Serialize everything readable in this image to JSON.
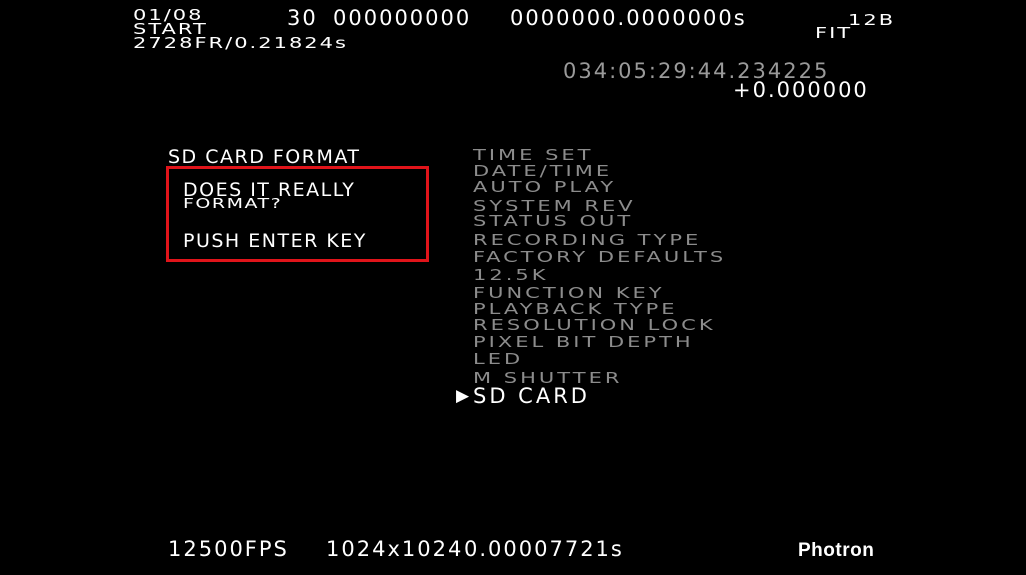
{
  "header": {
    "clip_index": "01/08",
    "trigger_mode": "START",
    "frames_time": "2728FR/0.21824s",
    "code_a": "30",
    "code_b": "000000000",
    "time_value": "0000000.0000000s",
    "bit_depth": "12B",
    "view_mode": "FIT",
    "timestamp": "034:05:29:44.234225",
    "offset": "+0.000000"
  },
  "dialog": {
    "title": "SD CARD FORMAT",
    "question_line1": "DOES IT REALLY",
    "question_line2": "FORMAT?",
    "instruction": "PUSH ENTER KEY"
  },
  "menu": {
    "items": [
      "TIME SET",
      "DATE/TIME",
      "AUTO PLAY",
      "SYSTEM REV",
      "STATUS OUT",
      "RECORDING TYPE",
      "FACTORY DEFAULTS",
      "12.5K",
      "FUNCTION KEY",
      "PLAYBACK TYPE",
      "RESOLUTION LOCK",
      "PIXEL BIT DEPTH",
      "LED",
      "M SHUTTER",
      "SD CARD"
    ],
    "selected_marker": "▶",
    "selected_item": "SD CARD"
  },
  "footer": {
    "frame_rate": "12500FPS",
    "resolution": "1024x1024",
    "shutter": "0.00007721s",
    "brand": "Photron"
  },
  "colors": {
    "background": "#000000",
    "text": "#ffffff",
    "menu_dim": "#8c8c8c",
    "dialog_border": "#e0141a"
  }
}
